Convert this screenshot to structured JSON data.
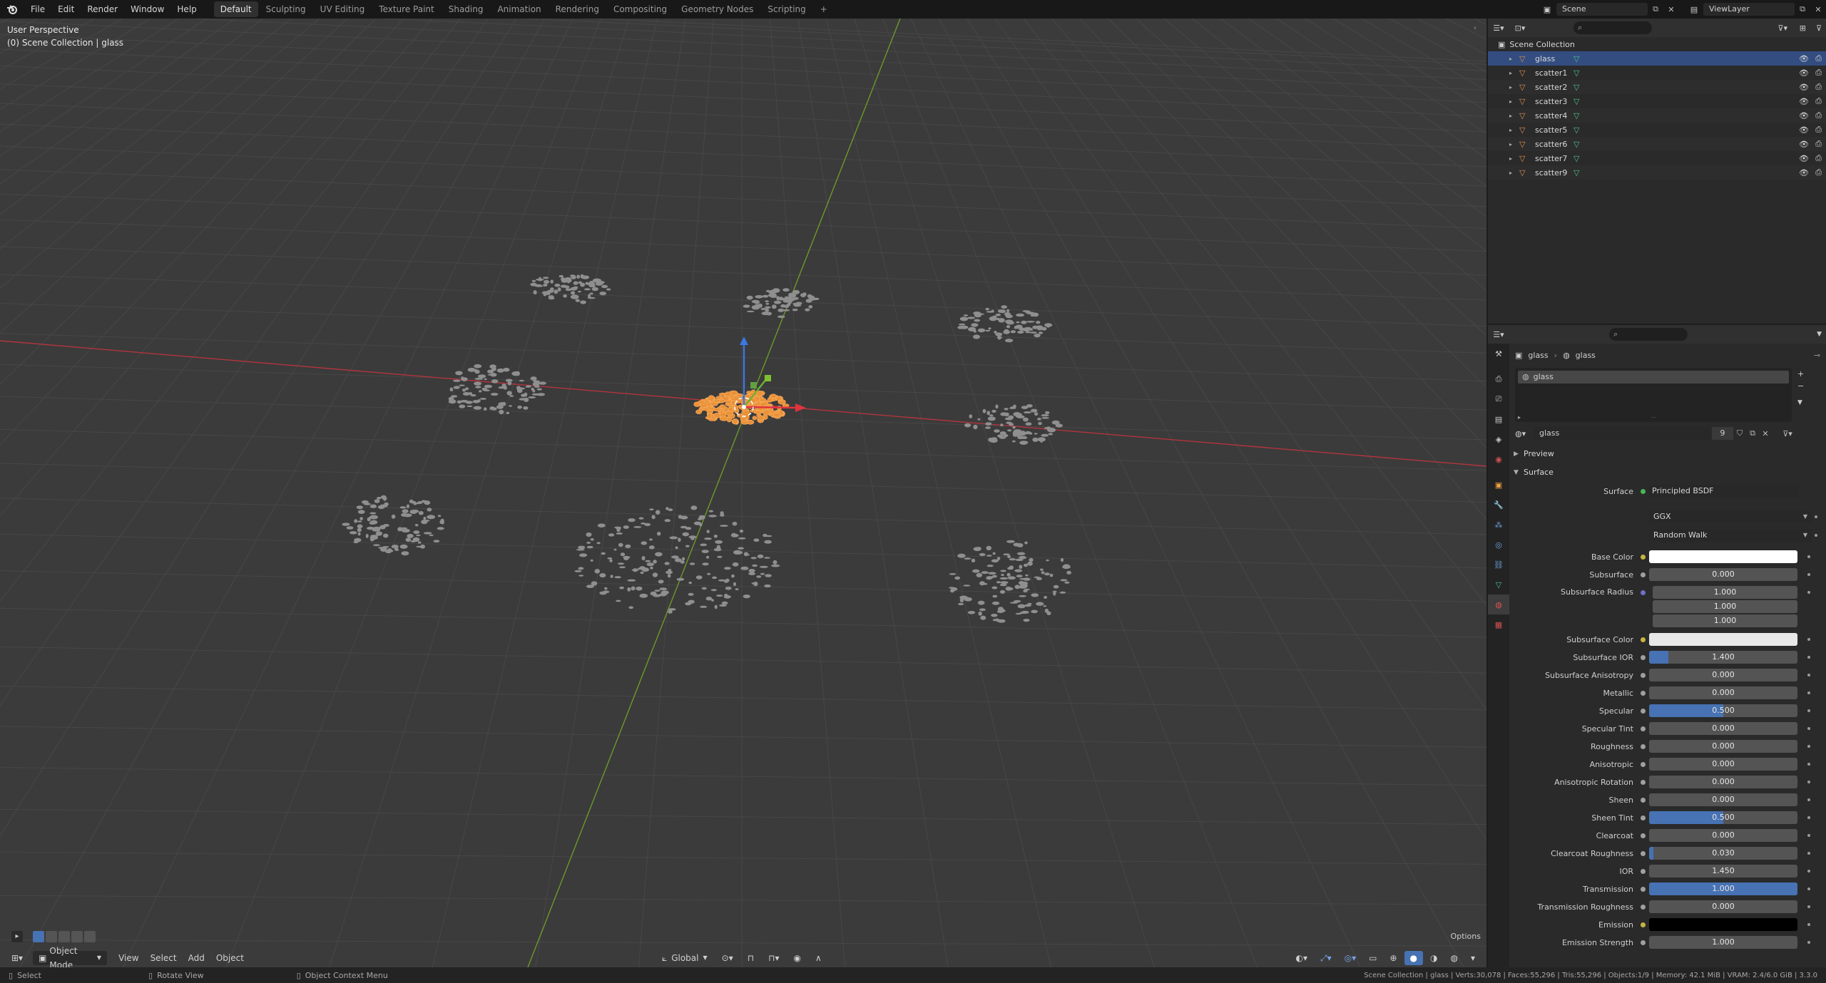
{
  "topbar": {
    "menus": [
      "File",
      "Edit",
      "Render",
      "Window",
      "Help"
    ],
    "workspaces": [
      "Default",
      "Sculpting",
      "UV Editing",
      "Texture Paint",
      "Shading",
      "Animation",
      "Rendering",
      "Compositing",
      "Geometry Nodes",
      "Scripting"
    ],
    "active_workspace": "Default",
    "add_tab": "+",
    "scene": "Scene",
    "view_layer": "ViewLayer"
  },
  "viewport": {
    "perspective": "User Perspective",
    "collection": "(0) Scene Collection | glass",
    "mode": "Object Mode",
    "menus": [
      "View",
      "Select",
      "Add",
      "Object"
    ],
    "transform": "Global",
    "options": "Options"
  },
  "outliner": {
    "root": "Scene Collection",
    "items": [
      {
        "name": "glass",
        "selected": true
      },
      {
        "name": "scatter1",
        "selected": false
      },
      {
        "name": "scatter2",
        "selected": false
      },
      {
        "name": "scatter3",
        "selected": false
      },
      {
        "name": "scatter4",
        "selected": false
      },
      {
        "name": "scatter5",
        "selected": false
      },
      {
        "name": "scatter6",
        "selected": false
      },
      {
        "name": "scatter7",
        "selected": false
      },
      {
        "name": "scatter9",
        "selected": false
      }
    ]
  },
  "properties": {
    "breadcrumb_object": "glass",
    "breadcrumb_material": "glass",
    "slot": "glass",
    "material_name": "glass",
    "user_count": "9",
    "preview_label": "Preview",
    "surface_label": "Surface",
    "surface_row": {
      "label": "Surface",
      "value": "Principled BSDF"
    },
    "distribution": "GGX",
    "subsurface_method": "Random Walk",
    "rows": [
      {
        "label": "Base Color",
        "type": "color",
        "color": "#ffffff",
        "dot": "yellow"
      },
      {
        "label": "Subsurface",
        "type": "slider",
        "value": "0.000",
        "fill": 0
      },
      {
        "label": "Subsurface Radius",
        "type": "vector",
        "values": [
          "1.000",
          "1.000",
          "1.000"
        ],
        "dot": "purple"
      },
      {
        "label": "Subsurface Color",
        "type": "color",
        "color": "#e8e8e8",
        "dot": "yellow"
      },
      {
        "label": "Subsurface IOR",
        "type": "slider",
        "value": "1.400",
        "fill": 0.13
      },
      {
        "label": "Subsurface Anisotropy",
        "type": "slider",
        "value": "0.000",
        "fill": 0
      },
      {
        "label": "Metallic",
        "type": "slider",
        "value": "0.000",
        "fill": 0
      },
      {
        "label": "Specular",
        "type": "slider",
        "value": "0.500",
        "fill": 0.5
      },
      {
        "label": "Specular Tint",
        "type": "slider",
        "value": "0.000",
        "fill": 0
      },
      {
        "label": "Roughness",
        "type": "slider",
        "value": "0.000",
        "fill": 0
      },
      {
        "label": "Anisotropic",
        "type": "slider",
        "value": "0.000",
        "fill": 0
      },
      {
        "label": "Anisotropic Rotation",
        "type": "slider",
        "value": "0.000",
        "fill": 0
      },
      {
        "label": "Sheen",
        "type": "slider",
        "value": "0.000",
        "fill": 0
      },
      {
        "label": "Sheen Tint",
        "type": "slider",
        "value": "0.500",
        "fill": 0.5
      },
      {
        "label": "Clearcoat",
        "type": "slider",
        "value": "0.000",
        "fill": 0
      },
      {
        "label": "Clearcoat Roughness",
        "type": "slider",
        "value": "0.030",
        "fill": 0.03
      },
      {
        "label": "IOR",
        "type": "slider",
        "value": "1.450",
        "fill": 0
      },
      {
        "label": "Transmission",
        "type": "slider",
        "value": "1.000",
        "fill": 1
      },
      {
        "label": "Transmission Roughness",
        "type": "slider",
        "value": "0.000",
        "fill": 0
      },
      {
        "label": "Emission",
        "type": "color",
        "color": "#000000",
        "dot": "yellow"
      },
      {
        "label": "Emission Strength",
        "type": "slider",
        "value": "1.000",
        "fill": 0
      }
    ]
  },
  "statusbar": {
    "select": "Select",
    "rotate": "Rotate View",
    "context": "Object Context Menu",
    "stats": "Scene Collection | glass | Verts:30,078 | Faces:55,296 | Tris:55,296 | Objects:1/9 | Memory: 42.1 MiB | VRAM: 2.4/6.0 GiB | 3.3.0"
  }
}
